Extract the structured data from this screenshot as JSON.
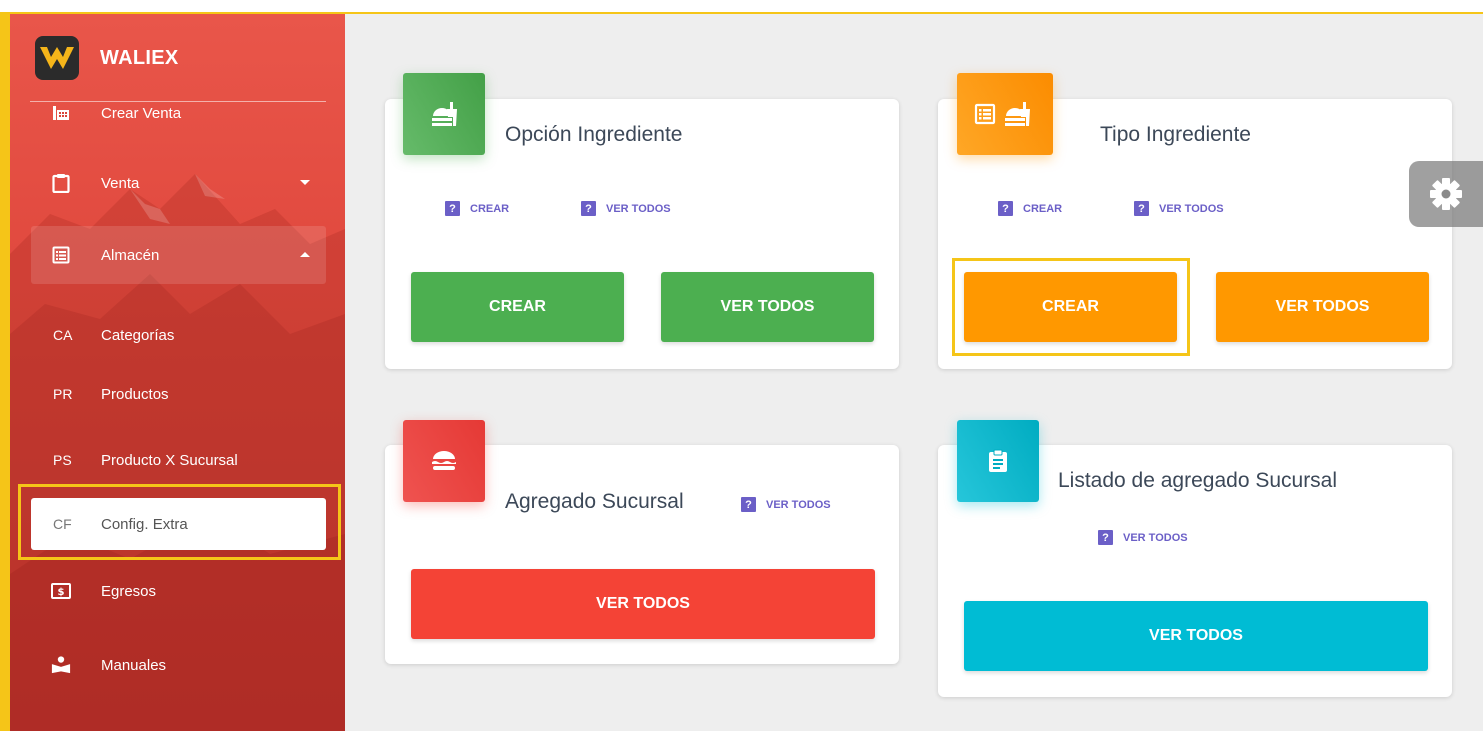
{
  "brand": {
    "name": "WALIEX",
    "logo": "waliex-logo"
  },
  "sidebar": {
    "items": [
      {
        "label": "Crear Venta",
        "icon": "cash-register-icon"
      },
      {
        "label": "Venta",
        "icon": "clipboard-icon"
      },
      {
        "label": "Almacén",
        "icon": "list-box-icon"
      },
      {
        "abbr": "CA",
        "label": "Categorías"
      },
      {
        "abbr": "PR",
        "label": "Productos"
      },
      {
        "abbr": "PS",
        "label": "Producto X Sucursal"
      },
      {
        "abbr": "CF",
        "label": "Config. Extra"
      },
      {
        "label": "Egresos",
        "icon": "dollar-box-icon"
      },
      {
        "label": "Manuales",
        "icon": "reader-icon"
      }
    ]
  },
  "cards": {
    "opcion": {
      "title": "Opción Ingrediente",
      "icon": "food-drink-icon",
      "link_crear": "CREAR",
      "link_ver": "VER TODOS",
      "btn_crear": "CREAR",
      "btn_ver": "VER TODOS",
      "color": "#4caf50"
    },
    "tipo": {
      "title": "Tipo Ingrediente",
      "icon": "list-food-icon",
      "link_crear": "CREAR",
      "link_ver": "VER TODOS",
      "btn_crear": "CREAR",
      "btn_ver": "VER TODOS",
      "color": "#ff9800"
    },
    "agregado": {
      "title": "Agregado Sucursal",
      "icon": "burger-icon",
      "link_ver": "VER TODOS",
      "btn_ver": "VER TODOS",
      "color": "#f44336"
    },
    "listado": {
      "title": "Listado de agregado Sucursal",
      "icon": "clipboard-list-icon",
      "link_ver": "VER TODOS",
      "btn_ver": "VER TODOS",
      "color": "#00bcd4"
    }
  },
  "help_glyph": "?",
  "settings": {
    "icon": "gear-icon"
  }
}
